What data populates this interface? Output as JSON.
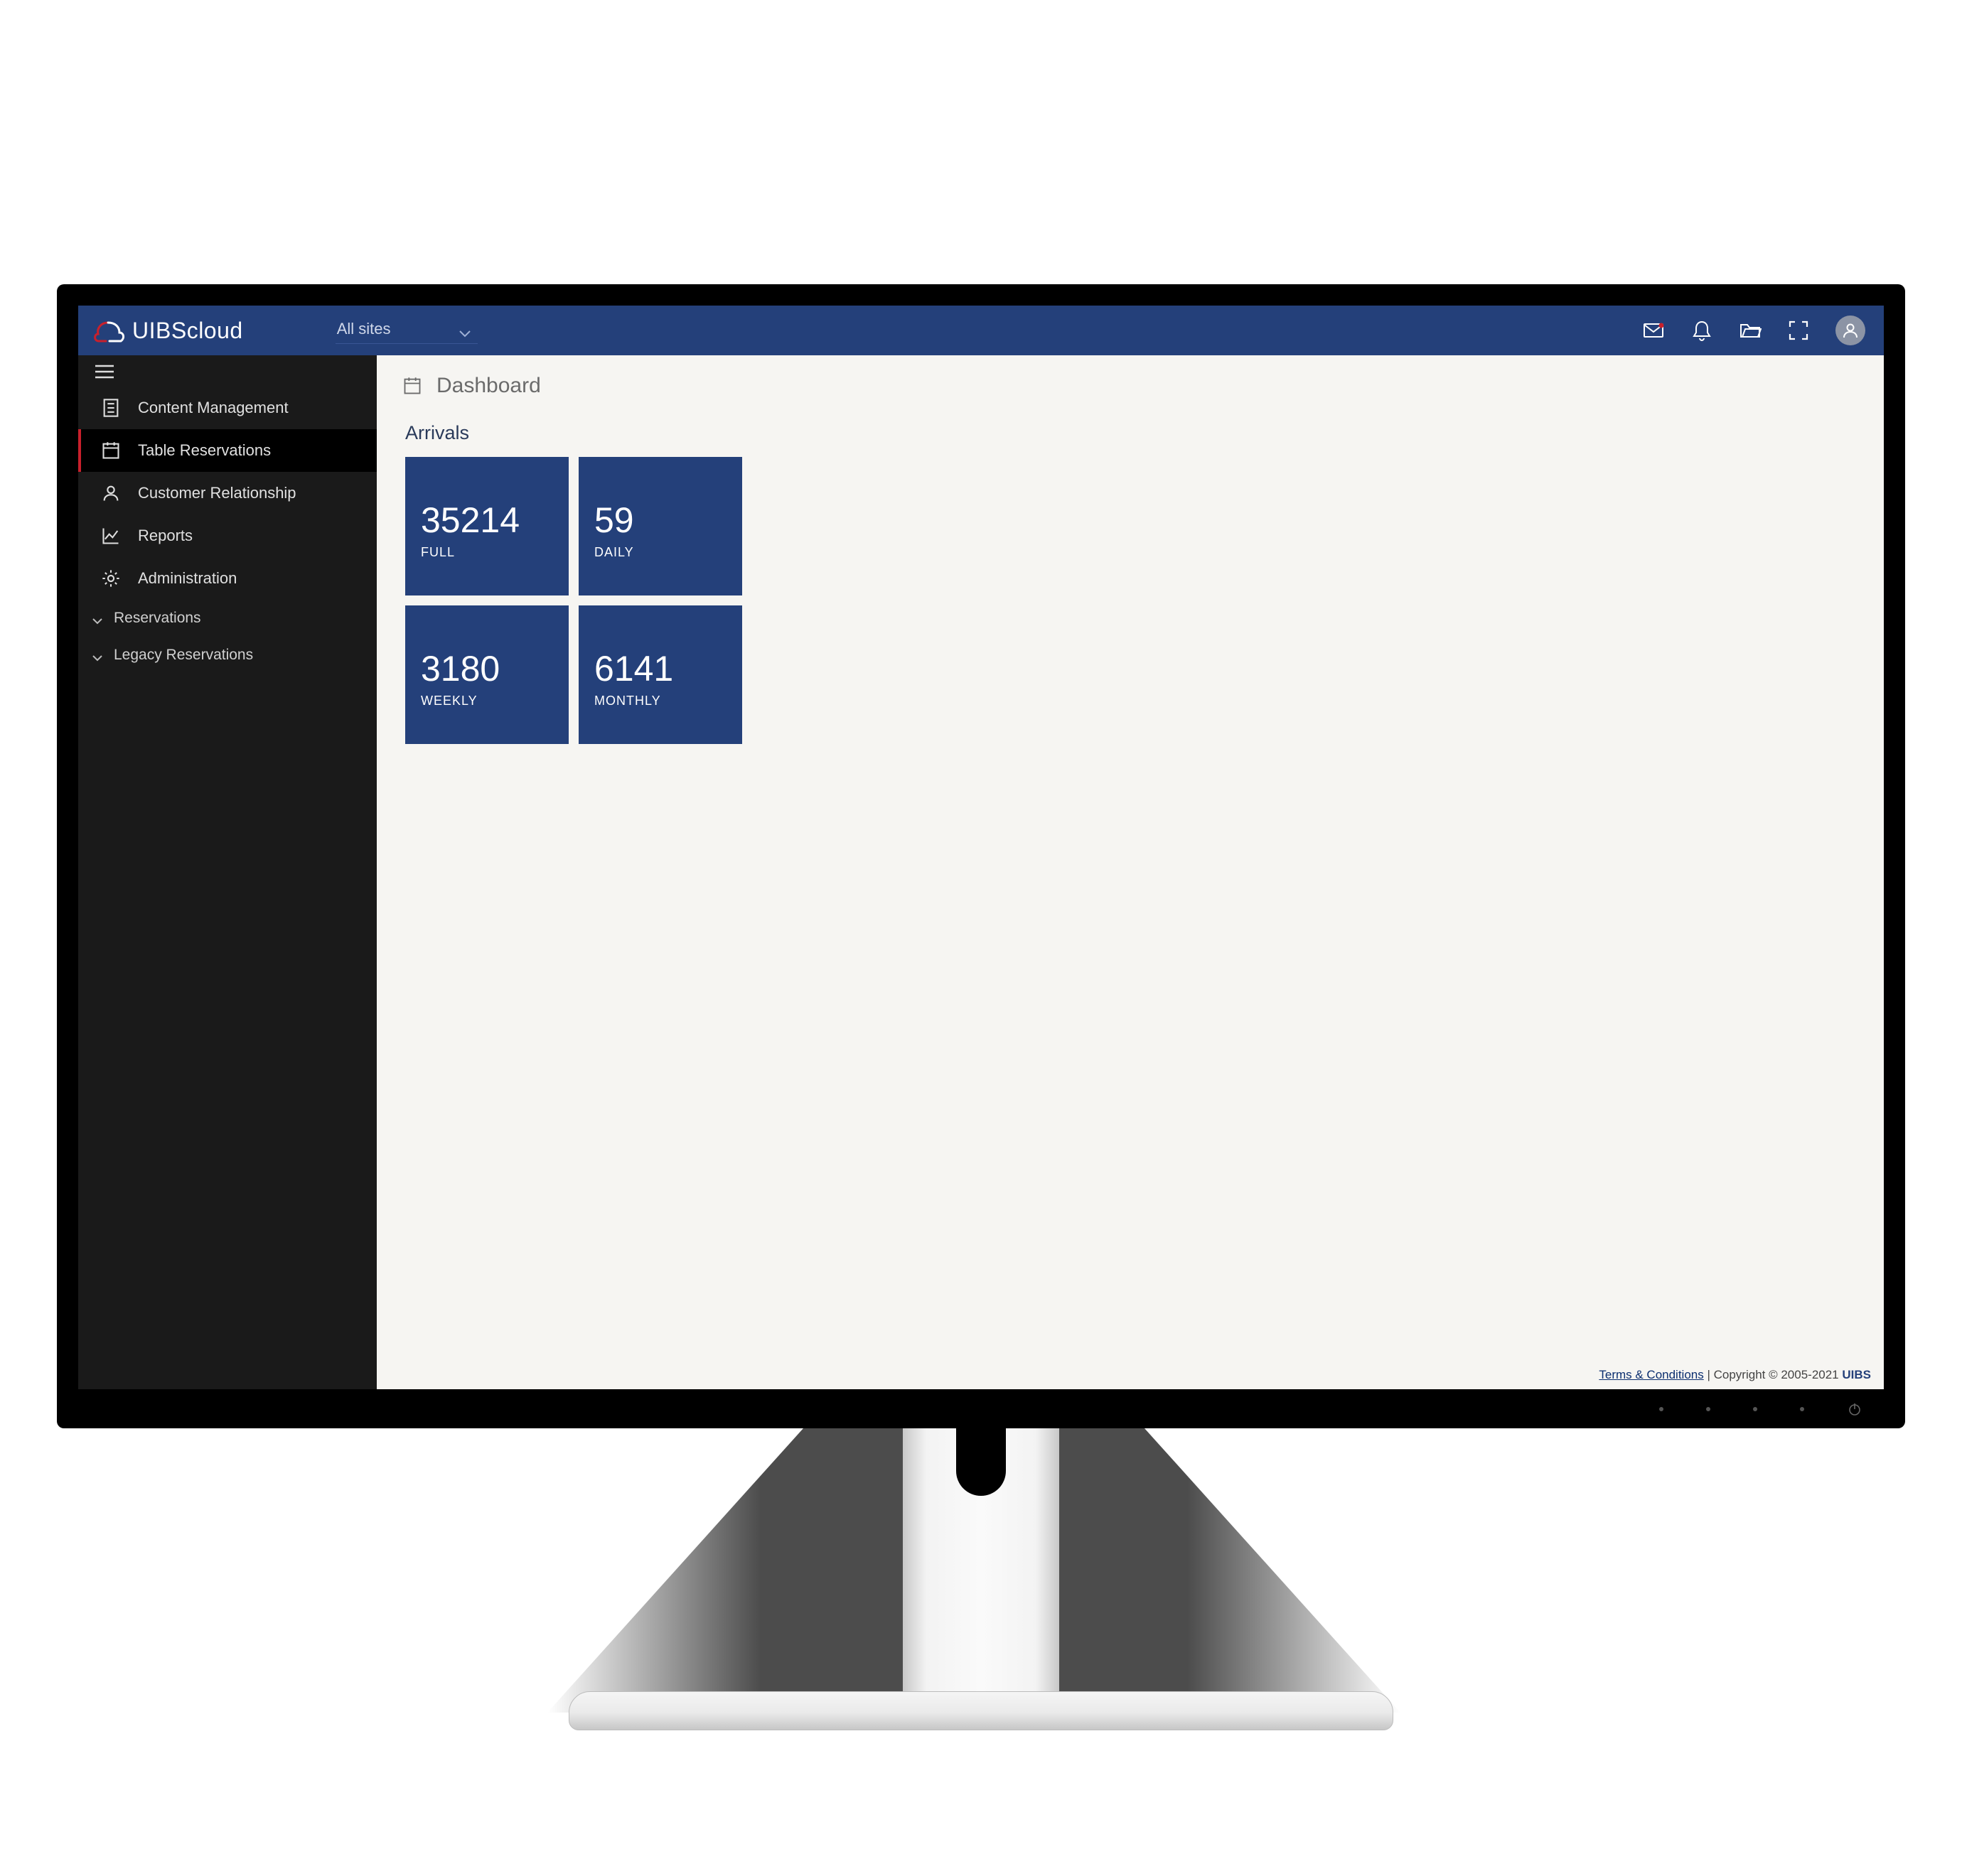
{
  "brand": {
    "name": "UIBScloud"
  },
  "site_selector": {
    "label": "All sites"
  },
  "sidebar": {
    "items": [
      {
        "label": "Content Management"
      },
      {
        "label": "Table Reservations"
      },
      {
        "label": "Customer Relationship"
      },
      {
        "label": "Reports"
      },
      {
        "label": "Administration"
      }
    ],
    "sub_items": [
      {
        "label": "Reservations"
      },
      {
        "label": "Legacy Reservations"
      }
    ]
  },
  "page": {
    "title": "Dashboard",
    "section": "Arrivals",
    "tiles": [
      {
        "value": "35214",
        "label": "FULL"
      },
      {
        "value": "59",
        "label": "DAILY"
      },
      {
        "value": "3180",
        "label": "WEEKLY"
      },
      {
        "value": "6141",
        "label": "MONTHLY"
      }
    ]
  },
  "footer": {
    "terms": "Terms & Conditions",
    "copyright": " | Copyright © 2005-2021 ",
    "brand": "UIBS"
  }
}
